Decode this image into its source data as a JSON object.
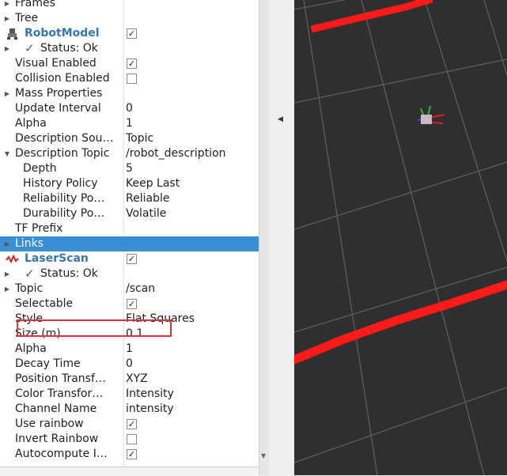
{
  "panel": {
    "top_items": [
      {
        "name": "Frames",
        "arrow": "right"
      },
      {
        "name": "Tree",
        "arrow": "right"
      }
    ],
    "robot_model": {
      "name": "RobotModel",
      "checked": true,
      "status": "Status: Ok",
      "props": [
        {
          "name": "Visual Enabled",
          "check": true
        },
        {
          "name": "Collision Enabled",
          "check": false
        },
        {
          "name": "Mass Properties",
          "arrow": "right"
        },
        {
          "name": "Update Interval",
          "value": "0"
        },
        {
          "name": "Alpha",
          "value": "1"
        },
        {
          "name": "Description Sou…",
          "value": "Topic"
        },
        {
          "name": "Description Topic",
          "value": "/robot_description",
          "arrow": "down"
        },
        {
          "name": "Depth",
          "value": "5",
          "indent": 2
        },
        {
          "name": "History Policy",
          "value": "Keep Last",
          "indent": 2
        },
        {
          "name": "Reliability Po…",
          "value": "Reliable",
          "indent": 2
        },
        {
          "name": "Durability Po…",
          "value": "Volatile",
          "indent": 2
        },
        {
          "name": "TF Prefix",
          "value": ""
        },
        {
          "name": "Links",
          "arrow": "right",
          "selected": true
        }
      ]
    },
    "laser_scan": {
      "name": "LaserScan",
      "checked": true,
      "status": "Status: Ok",
      "props": [
        {
          "name": "Topic",
          "value": "/scan",
          "arrow": "right"
        },
        {
          "name": "Selectable",
          "check": true
        },
        {
          "name": "Style",
          "value": "Flat Squares"
        },
        {
          "name": "Size (m)",
          "value": "0.1"
        },
        {
          "name": "Alpha",
          "value": "1"
        },
        {
          "name": "Decay Time",
          "value": "0"
        },
        {
          "name": "Position Transf…",
          "value": "XYZ"
        },
        {
          "name": "Color Transfor…",
          "value": "Intensity"
        },
        {
          "name": "Channel Name",
          "value": "intensity"
        },
        {
          "name": "Use rainbow",
          "check": true
        },
        {
          "name": "Invert Rainbow",
          "check": false
        },
        {
          "name": "Autocompute I…",
          "check": true
        }
      ]
    }
  },
  "colors": {
    "selection": "#3a8fd4",
    "display_name": "#3676b4",
    "highlight_box": "#d9363a",
    "viewport_bg": "#2f2f2f",
    "grid": "#5a5a5a",
    "scan": "#ff1a1a"
  },
  "icons": {
    "robot_model": "robot-icon",
    "laser_scan": "laser-wave-icon",
    "status_ok": "checkmark-icon"
  }
}
